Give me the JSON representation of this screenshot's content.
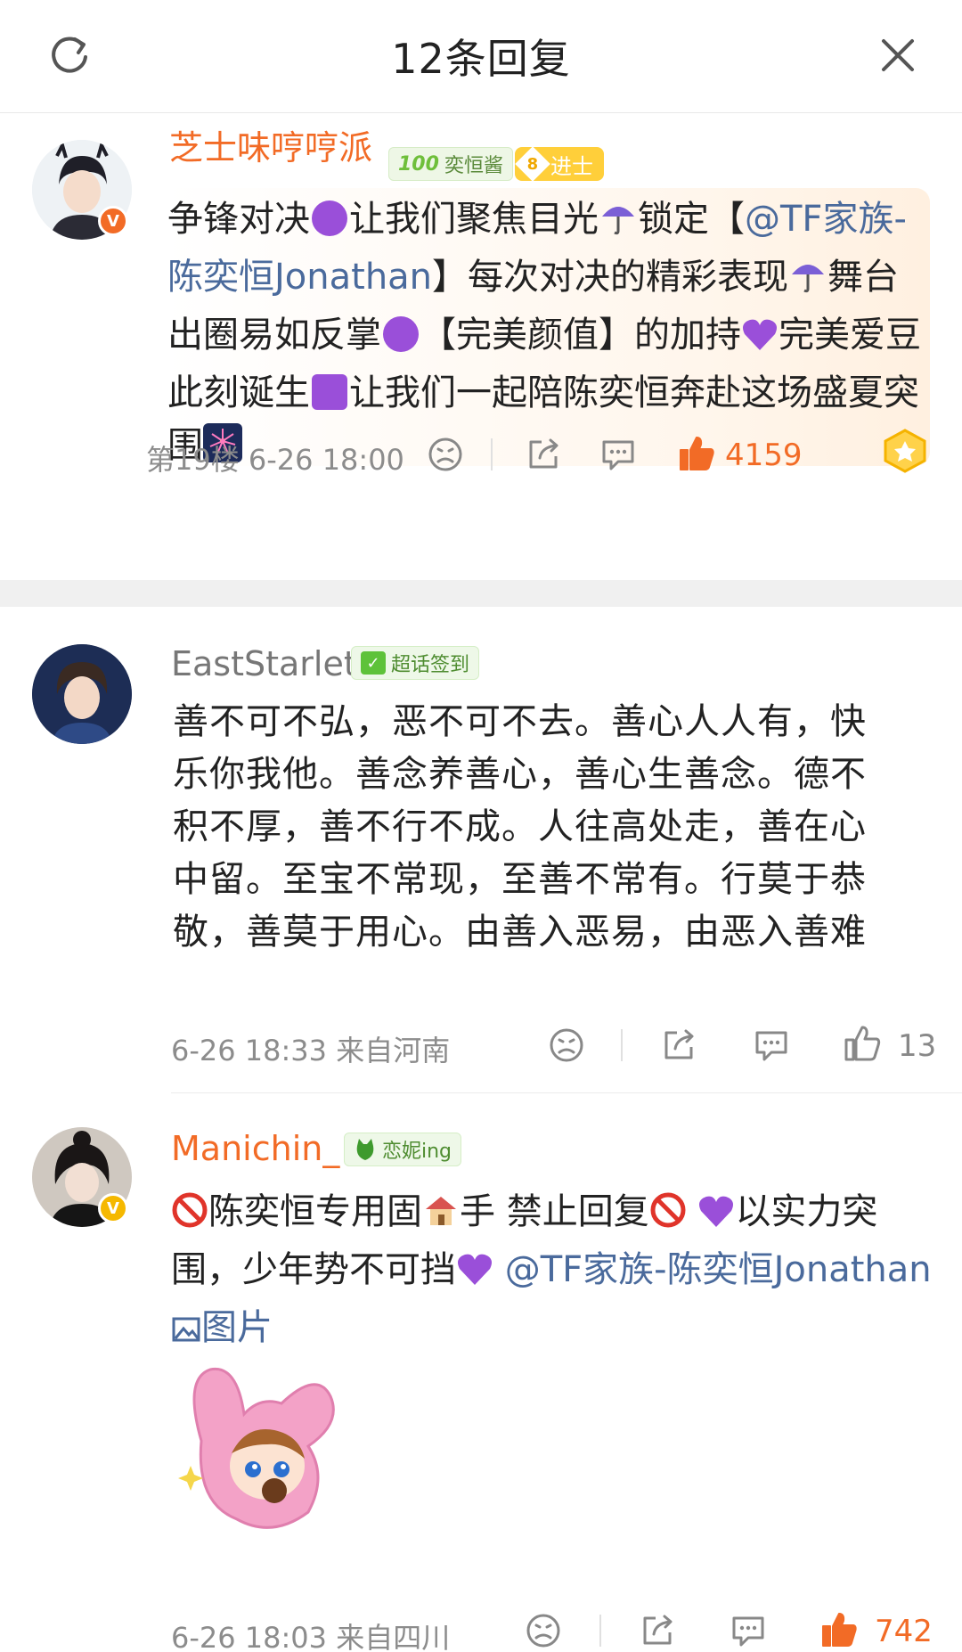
{
  "header": {
    "title": "12条回复"
  },
  "comments": [
    {
      "username": "芝士味哼哼派",
      "fan_badge": "奕恒酱",
      "level_badge_num": "8",
      "level_badge_text": "进士",
      "text": {
        "p1": "争锋对决",
        "p2": "让我们聚焦目光",
        "p3": "锁定【",
        "mention": "@TF家族-陈奕恒Jonathan",
        "p4": "】每次对决的精彩表现",
        "p5": "舞台出圈易如反掌",
        "p6": "【完美颜值】的加持",
        "p7": "完美爱豆此刻诞生",
        "p8": "让我们一起陪陈奕恒奔赴这场盛夏突围"
      },
      "meta": "第19楼  6-26 18:00",
      "likes": "4159",
      "liked": true
    },
    {
      "username": "EastStarlet",
      "fan_badge": "超话签到",
      "text": "善不可不弘，恶不可不去。善心人人有，快乐你我他。善念养善心，善心生善念。德不积不厚，善不行不成。人往高处走，善在心中留。至宝不常现，至善不常有。行莫于恭敬，善莫于用心。由善入恶易，由恶入善难",
      "meta": "6-26 18:33  来自河南",
      "likes": "13",
      "liked": false
    },
    {
      "username": "Manichin_",
      "fan_badge": "恋妮ing",
      "text": {
        "p1": "陈奕恒专用固",
        "p2": "手 禁止回复",
        "p3": "以实力突围，少年势不可挡",
        "mention": "@TF家族-陈奕恒Jonathan",
        "image_link": "图片"
      },
      "meta": "6-26 18:03  来自四川",
      "likes": "742",
      "liked": true
    }
  ],
  "colors": {
    "accent": "#f26b26",
    "link": "#4a6a9c",
    "meta": "#8c8c8c"
  }
}
